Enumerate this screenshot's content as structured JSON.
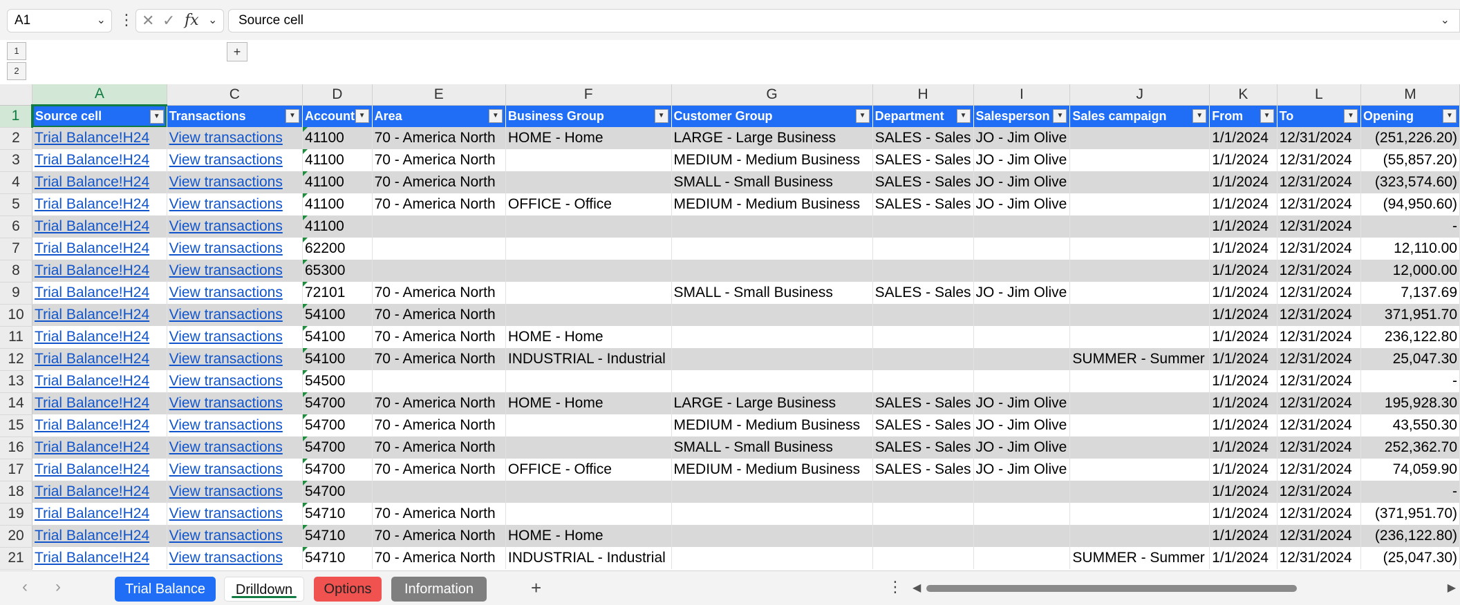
{
  "formula_bar": {
    "name_box": "A1",
    "formula": "Source cell",
    "fx_label": "fx",
    "cancel_icon": "close-icon",
    "confirm_icon": "check-icon"
  },
  "outline": {
    "levels": [
      "1",
      "2"
    ],
    "expand": "+"
  },
  "columns": [
    "A",
    "C",
    "D",
    "E",
    "F",
    "G",
    "H",
    "I",
    "J",
    "K",
    "L",
    "M"
  ],
  "headers": [
    "Source cell",
    "Transactions",
    "Account",
    "Area",
    "Business Group",
    "Customer Group",
    "Department",
    "Salesperson",
    "Sales campaign",
    "From",
    "To",
    "Opening"
  ],
  "rows": [
    {
      "num": "2",
      "a": "Trial Balance!H24",
      "c": "View transactions",
      "d": "41100",
      "e": "70 - America North",
      "f": "HOME - Home",
      "g": "LARGE - Large Business",
      "h": "SALES - Sales",
      "i": "JO - Jim Olive",
      "j": "",
      "k": "1/1/2024",
      "l": "12/31/2024",
      "m": "(251,226.20)"
    },
    {
      "num": "3",
      "a": "Trial Balance!H24",
      "c": "View transactions",
      "d": "41100",
      "e": "70 - America North",
      "f": "",
      "g": "MEDIUM - Medium Business",
      "h": "SALES - Sales",
      "i": "JO - Jim Olive",
      "j": "",
      "k": "1/1/2024",
      "l": "12/31/2024",
      "m": "(55,857.20)"
    },
    {
      "num": "4",
      "a": "Trial Balance!H24",
      "c": "View transactions",
      "d": "41100",
      "e": "70 - America North",
      "f": "",
      "g": "SMALL - Small Business",
      "h": "SALES - Sales",
      "i": "JO - Jim Olive",
      "j": "",
      "k": "1/1/2024",
      "l": "12/31/2024",
      "m": "(323,574.60)"
    },
    {
      "num": "5",
      "a": "Trial Balance!H24",
      "c": "View transactions",
      "d": "41100",
      "e": "70 - America North",
      "f": "OFFICE - Office",
      "g": "MEDIUM - Medium Business",
      "h": "SALES - Sales",
      "i": "JO - Jim Olive",
      "j": "",
      "k": "1/1/2024",
      "l": "12/31/2024",
      "m": "(94,950.60)"
    },
    {
      "num": "6",
      "a": "Trial Balance!H24",
      "c": "View transactions",
      "d": "41100",
      "e": "",
      "f": "",
      "g": "",
      "h": "",
      "i": "",
      "j": "",
      "k": "1/1/2024",
      "l": "12/31/2024",
      "m": "-"
    },
    {
      "num": "7",
      "a": "Trial Balance!H24",
      "c": "View transactions",
      "d": "62200",
      "e": "",
      "f": "",
      "g": "",
      "h": "",
      "i": "",
      "j": "",
      "k": "1/1/2024",
      "l": "12/31/2024",
      "m": "12,110.00"
    },
    {
      "num": "8",
      "a": "Trial Balance!H24",
      "c": "View transactions",
      "d": "65300",
      "e": "",
      "f": "",
      "g": "",
      "h": "",
      "i": "",
      "j": "",
      "k": "1/1/2024",
      "l": "12/31/2024",
      "m": "12,000.00"
    },
    {
      "num": "9",
      "a": "Trial Balance!H24",
      "c": "View transactions",
      "d": "72101",
      "e": "70 - America North",
      "f": "",
      "g": "SMALL - Small Business",
      "h": "SALES - Sales",
      "i": "JO - Jim Olive",
      "j": "",
      "k": "1/1/2024",
      "l": "12/31/2024",
      "m": "7,137.69"
    },
    {
      "num": "10",
      "a": "Trial Balance!H24",
      "c": "View transactions",
      "d": "54100",
      "e": "70 - America North",
      "f": "",
      "g": "",
      "h": "",
      "i": "",
      "j": "",
      "k": "1/1/2024",
      "l": "12/31/2024",
      "m": "371,951.70"
    },
    {
      "num": "11",
      "a": "Trial Balance!H24",
      "c": "View transactions",
      "d": "54100",
      "e": "70 - America North",
      "f": "HOME - Home",
      "g": "",
      "h": "",
      "i": "",
      "j": "",
      "k": "1/1/2024",
      "l": "12/31/2024",
      "m": "236,122.80"
    },
    {
      "num": "12",
      "a": "Trial Balance!H24",
      "c": "View transactions",
      "d": "54100",
      "e": "70 - America North",
      "f": "INDUSTRIAL - Industrial",
      "g": "",
      "h": "",
      "i": "",
      "j": "SUMMER - Summer",
      "k": "1/1/2024",
      "l": "12/31/2024",
      "m": "25,047.30"
    },
    {
      "num": "13",
      "a": "Trial Balance!H24",
      "c": "View transactions",
      "d": "54500",
      "e": "",
      "f": "",
      "g": "",
      "h": "",
      "i": "",
      "j": "",
      "k": "1/1/2024",
      "l": "12/31/2024",
      "m": "-"
    },
    {
      "num": "14",
      "a": "Trial Balance!H24",
      "c": "View transactions",
      "d": "54700",
      "e": "70 - America North",
      "f": "HOME - Home",
      "g": "LARGE - Large Business",
      "h": "SALES - Sales",
      "i": "JO - Jim Olive",
      "j": "",
      "k": "1/1/2024",
      "l": "12/31/2024",
      "m": "195,928.30"
    },
    {
      "num": "15",
      "a": "Trial Balance!H24",
      "c": "View transactions",
      "d": "54700",
      "e": "70 - America North",
      "f": "",
      "g": "MEDIUM - Medium Business",
      "h": "SALES - Sales",
      "i": "JO - Jim Olive",
      "j": "",
      "k": "1/1/2024",
      "l": "12/31/2024",
      "m": "43,550.30"
    },
    {
      "num": "16",
      "a": "Trial Balance!H24",
      "c": "View transactions",
      "d": "54700",
      "e": "70 - America North",
      "f": "",
      "g": "SMALL - Small Business",
      "h": "SALES - Sales",
      "i": "JO - Jim Olive",
      "j": "",
      "k": "1/1/2024",
      "l": "12/31/2024",
      "m": "252,362.70"
    },
    {
      "num": "17",
      "a": "Trial Balance!H24",
      "c": "View transactions",
      "d": "54700",
      "e": "70 - America North",
      "f": "OFFICE - Office",
      "g": "MEDIUM - Medium Business",
      "h": "SALES - Sales",
      "i": "JO - Jim Olive",
      "j": "",
      "k": "1/1/2024",
      "l": "12/31/2024",
      "m": "74,059.90"
    },
    {
      "num": "18",
      "a": "Trial Balance!H24",
      "c": "View transactions",
      "d": "54700",
      "e": "",
      "f": "",
      "g": "",
      "h": "",
      "i": "",
      "j": "",
      "k": "1/1/2024",
      "l": "12/31/2024",
      "m": "-"
    },
    {
      "num": "19",
      "a": "Trial Balance!H24",
      "c": "View transactions",
      "d": "54710",
      "e": "70 - America North",
      "f": "",
      "g": "",
      "h": "",
      "i": "",
      "j": "",
      "k": "1/1/2024",
      "l": "12/31/2024",
      "m": "(371,951.70)"
    },
    {
      "num": "20",
      "a": "Trial Balance!H24",
      "c": "View transactions",
      "d": "54710",
      "e": "70 - America North",
      "f": "HOME - Home",
      "g": "",
      "h": "",
      "i": "",
      "j": "",
      "k": "1/1/2024",
      "l": "12/31/2024",
      "m": "(236,122.80)"
    },
    {
      "num": "21",
      "a": "Trial Balance!H24",
      "c": "View transactions",
      "d": "54710",
      "e": "70 - America North",
      "f": "INDUSTRIAL - Industrial",
      "g": "",
      "h": "",
      "i": "",
      "j": "SUMMER - Summer",
      "k": "1/1/2024",
      "l": "12/31/2024",
      "m": "(25,047.30)"
    }
  ],
  "sheet_tabs": [
    {
      "label": "Trial Balance",
      "color": "#1f6ef5"
    },
    {
      "label": "Drilldown",
      "color": "#ffffff",
      "active": true
    },
    {
      "label": "Options",
      "color": "#f0524f"
    },
    {
      "label": "Information",
      "color": "#7f7f7f"
    }
  ],
  "colors": {
    "header_fill": "#1f6ef5",
    "band_fill": "#d9d9d9",
    "link": "#1155cc",
    "accent": "#107c41"
  }
}
